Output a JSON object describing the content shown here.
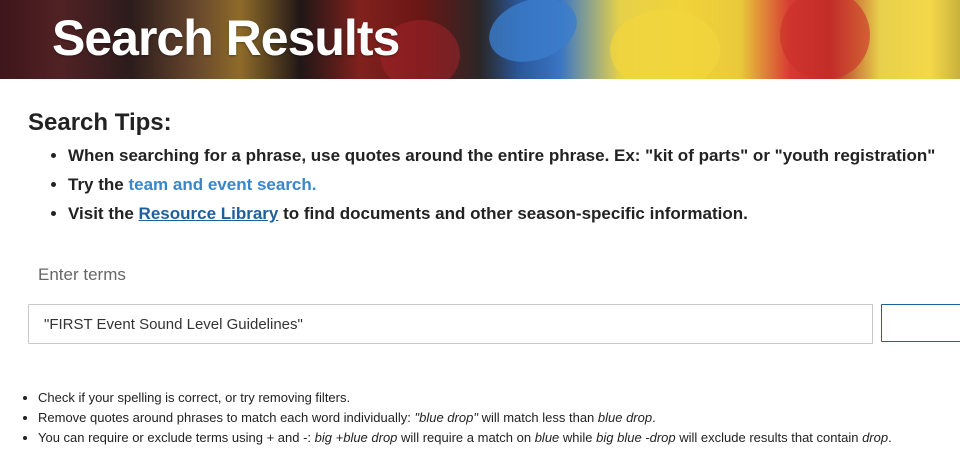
{
  "hero": {
    "title": "Search Results"
  },
  "tips": {
    "heading": "Search Tips:",
    "items": [
      {
        "text": "When searching for a phrase, use quotes around the entire phrase. Ex: \"kit of parts\" or \"youth registration\""
      },
      {
        "prefix": "Try the ",
        "link": "team and event search."
      },
      {
        "prefix": "Visit the ",
        "link": "Resource Library",
        "suffix": " to find documents and other season-specific information."
      }
    ]
  },
  "search": {
    "label": "Enter terms",
    "value": "\"FIRST Event Sound Level Guidelines\""
  },
  "help": {
    "item1": "Check if your spelling is correct, or try removing filters.",
    "item2": {
      "a": "Remove quotes around phrases to match each word individually: ",
      "b": "\"blue drop\"",
      "c": " will match less than ",
      "d": "blue drop",
      "e": "."
    },
    "item3": {
      "a": "You can require or exclude terms using + and -: ",
      "b": "big +blue drop",
      "c": " will require a match on ",
      "d": "blue",
      "e": " while ",
      "f": "big blue -drop",
      "g": " will exclude results that contain ",
      "h": "drop",
      "i": "."
    }
  },
  "colors": {
    "link": "#3a86c8",
    "link_underlined": "#1e5f9e",
    "button_border": "#1e5f9e"
  }
}
